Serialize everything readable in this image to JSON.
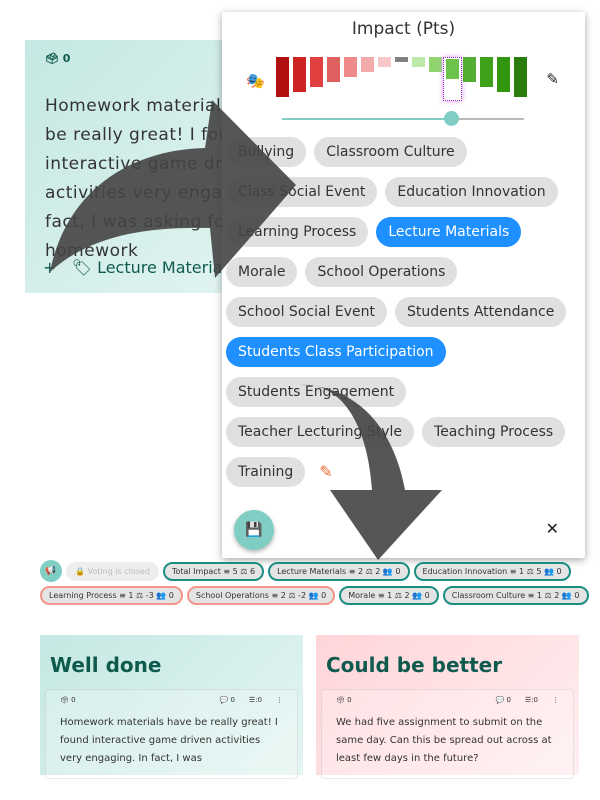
{
  "background_card": {
    "vote_count": "0",
    "text": "Homework materials have be really great! I found interactive game driven activities very engaging. In fact, I was asking for more homework",
    "tag": "Lecture Materials"
  },
  "popover": {
    "title": "Impact (Pts)",
    "scale": {
      "values": [
        -7,
        -6,
        -5,
        -4,
        -3,
        -2,
        -1,
        0,
        1,
        2,
        3,
        4,
        5,
        6,
        7
      ],
      "selected": 3,
      "slider_fraction": 0.7,
      "colors": [
        "#b01010",
        "#cc2424",
        "#e04040",
        "#e06060",
        "#ee8a8a",
        "#f3aaaa",
        "#f8c8c8",
        "#808080",
        "#bde9a8",
        "#8fd46e",
        "#6cc24a",
        "#52ae32",
        "#3ea118",
        "#33960f",
        "#2a7d0a"
      ]
    },
    "tags": [
      {
        "label": "Bullying",
        "selected": false
      },
      {
        "label": "Classroom Culture",
        "selected": false
      },
      {
        "label": "Class Social Event",
        "selected": false
      },
      {
        "label": "Education Innovation",
        "selected": false
      },
      {
        "label": "Learning Process",
        "selected": false
      },
      {
        "label": "Lecture Materials",
        "selected": true
      },
      {
        "label": "Morale",
        "selected": false
      },
      {
        "label": "School Operations",
        "selected": false
      },
      {
        "label": "School Social Event",
        "selected": false
      },
      {
        "label": "Students Attendance",
        "selected": false
      },
      {
        "label": "Students Class Participation",
        "selected": true
      },
      {
        "label": "Students Engagement",
        "selected": false
      },
      {
        "label": "Teacher Lecturing Style",
        "selected": false
      },
      {
        "label": "Teaching Process",
        "selected": false
      },
      {
        "label": "Training",
        "selected": false
      }
    ]
  },
  "summary": {
    "voting": "Voting is closed",
    "chips": [
      {
        "text": "Total Impact ≡ 5 ⚖ 6",
        "neg": false
      },
      {
        "text": "Lecture Materials ≡ 2 ⚖ 2 👥 0",
        "neg": false
      },
      {
        "text": "Education Innovation ≡ 1 ⚖ 5 👥 0",
        "neg": false
      },
      {
        "text": "Learning Process ≡ 1 ⚖ -3 👥 0",
        "neg": true
      },
      {
        "text": "School Operations ≡ 2 ⚖ -2 👥 0",
        "neg": true
      },
      {
        "text": "Morale ≡ 1 ⚖ 2 👥 0",
        "neg": false
      },
      {
        "text": "Classroom Culture ≡ 1 ⚖ 2 👥 0",
        "neg": false
      }
    ]
  },
  "columns": [
    {
      "title": "Well done",
      "votes": "0",
      "comments": "0",
      "items": ":0",
      "text": "Homework materials have be really great! I found interactive game driven activities very engaging. In fact, I was"
    },
    {
      "title": "Could be better",
      "votes": "0",
      "comments": "0",
      "items": ":0",
      "text": "We had five assignment to submit on the same day. Can this be spread out across at least few days in the future?"
    }
  ]
}
